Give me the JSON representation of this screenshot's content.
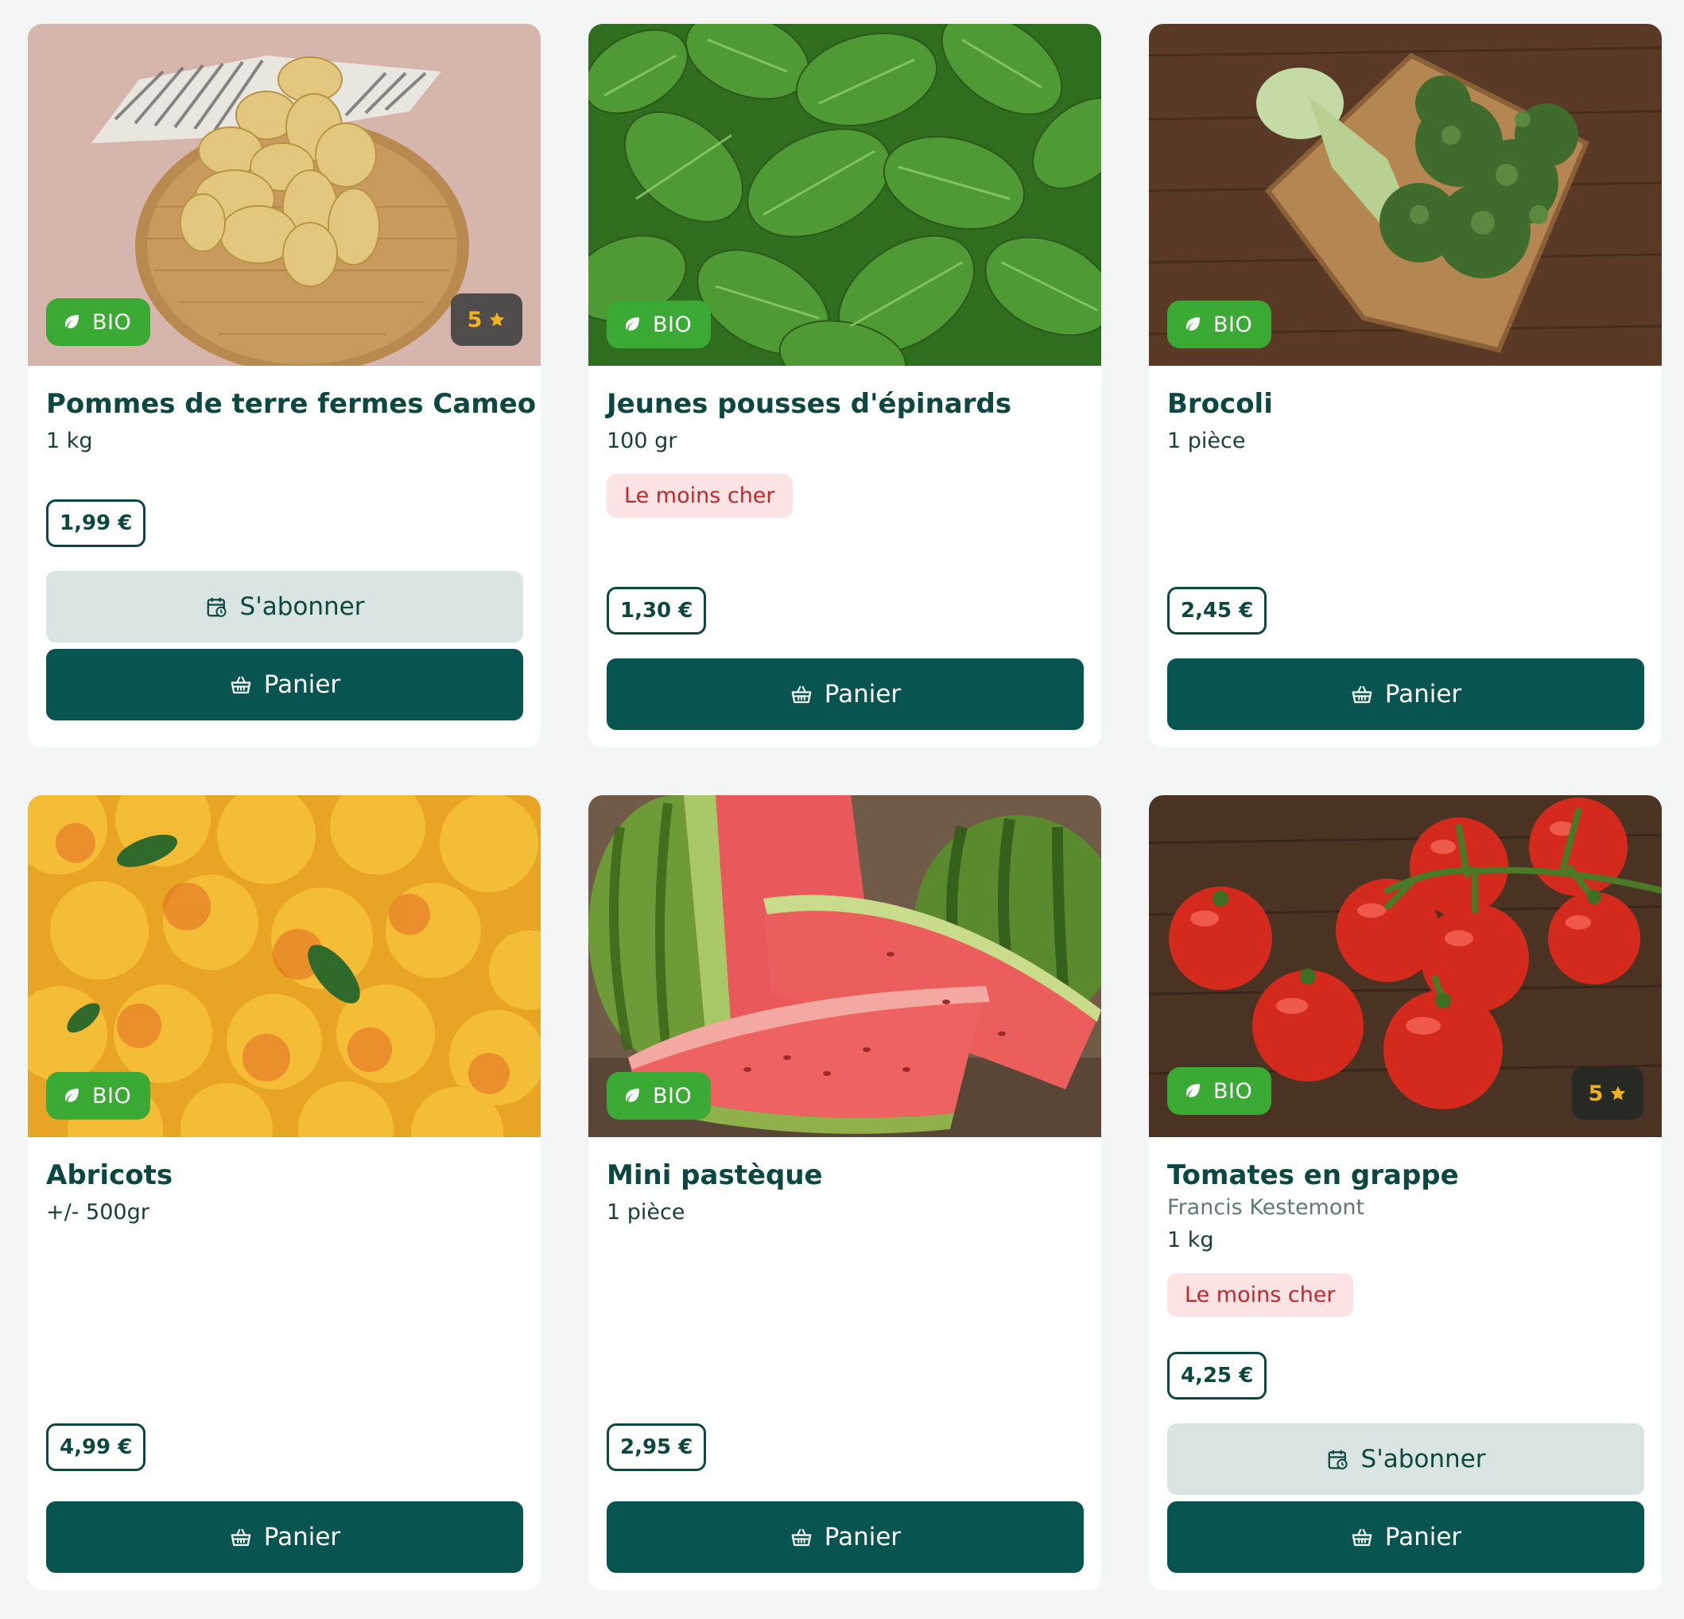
{
  "labels": {
    "bio": "BIO",
    "subscribe": "S'abonner",
    "cart": "Panier",
    "cheapest": "Le moins cher"
  },
  "colors": {
    "bio_badge": "#3aaa35",
    "primary_button": "#075450",
    "subscribe_button": "#d9e4e3",
    "cheapest_badge_bg": "#fde3e3",
    "cheapest_badge_text": "#c0282b",
    "rating_star": "#f2b21b"
  },
  "icons": {
    "bio": "leaf-icon",
    "rating": "star-icon",
    "subscribe": "calendar-clock-icon",
    "cart": "basket-icon"
  },
  "products": [
    {
      "name": "Pommes de terre fermes Cameo",
      "quantity": "1 kg",
      "price": "1,99 €",
      "rating": "5",
      "image": "potatoes"
    },
    {
      "name": "Jeunes pousses d'épinards",
      "quantity": "100 gr",
      "price": "1,30 €",
      "badge": "Le moins cher",
      "image": "spinach"
    },
    {
      "name": "Brocoli",
      "quantity": "1 pièce",
      "price": "2,45 €",
      "image": "broccoli"
    },
    {
      "name": "Abricots",
      "quantity": "+/- 500gr",
      "price": "4,99 €",
      "image": "apricots"
    },
    {
      "name": "Mini pastèque",
      "quantity": "1 pièce",
      "price": "2,95 €",
      "image": "watermelon"
    },
    {
      "name": "Tomates en grappe",
      "producer": "Francis Kestemont",
      "quantity": "1 kg",
      "price": "4,25 €",
      "badge": "Le moins cher",
      "rating": "5",
      "image": "tomatoes"
    }
  ]
}
